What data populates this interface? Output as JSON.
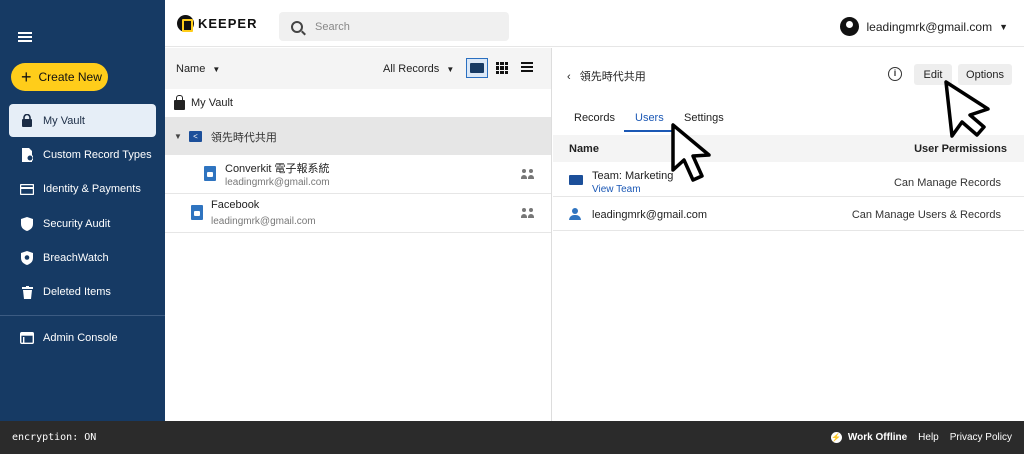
{
  "sidebar": {
    "create_label": "Create New",
    "items": [
      {
        "label": "My Vault",
        "icon": "lock-icon",
        "active": true
      },
      {
        "label": "Custom Record Types",
        "icon": "record-type-icon"
      },
      {
        "label": "Identity & Payments",
        "icon": "credit-card-icon"
      },
      {
        "label": "Security Audit",
        "icon": "shield-icon"
      },
      {
        "label": "BreachWatch",
        "icon": "breachwatch-icon"
      },
      {
        "label": "Deleted Items",
        "icon": "trash-icon"
      },
      {
        "label": "Admin Console",
        "icon": "console-icon"
      }
    ]
  },
  "header": {
    "brand": "KEEPER",
    "search_placeholder": "Search",
    "account_email": "leadingmrk@gmail.com"
  },
  "list": {
    "sort_label": "Name",
    "filter_label": "All Records",
    "vault_label": "My Vault",
    "shared_folder": "領先時代共用",
    "records": [
      {
        "title": "Converkit 電子報系統",
        "login": "leadingmrk@gmail.com"
      },
      {
        "title": "Facebook",
        "login": "leadingmrk@gmail.com"
      }
    ]
  },
  "detail": {
    "folder_title": "領先時代共用",
    "edit_label": "Edit",
    "options_label": "Options",
    "tabs": [
      "Records",
      "Users",
      "Settings"
    ],
    "active_tab": "Users",
    "columns": {
      "name": "Name",
      "permissions": "User Permissions"
    },
    "rows": [
      {
        "name": "Team: Marketing",
        "link": "View Team",
        "permission": "Can Manage Records",
        "icon": "team-icon"
      },
      {
        "name": "leadingmrk@gmail.com",
        "permission": "Can Manage Users & Records",
        "icon": "user-icon"
      }
    ]
  },
  "footer": {
    "encryption": "encryption: ON",
    "work_offline": "Work Offline",
    "help": "Help",
    "privacy": "Privacy Policy"
  },
  "colors": {
    "sidebar": "#163a64",
    "accent_yellow": "#ffcd1a",
    "link_blue": "#1b58b5"
  }
}
